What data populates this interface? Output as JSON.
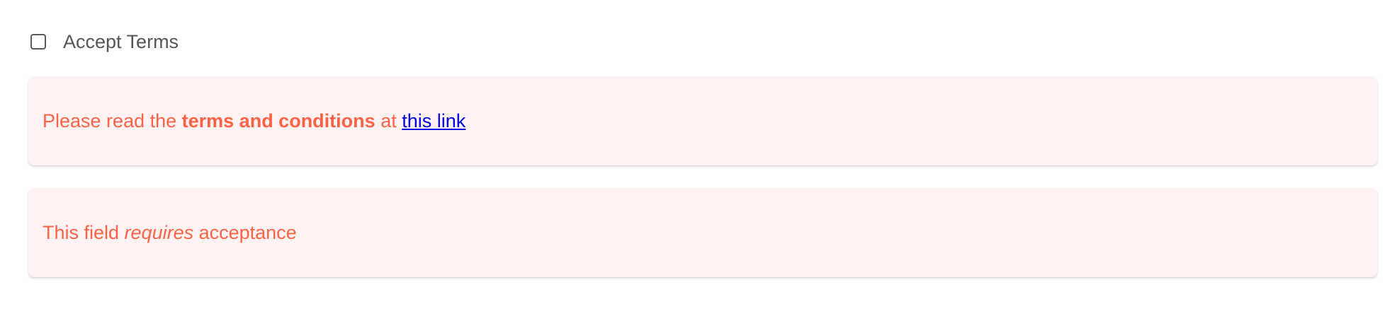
{
  "checkbox": {
    "label": "Accept Terms",
    "checked": false
  },
  "terms_notice": {
    "prefix": "Please read the ",
    "strong": "terms and conditions",
    "middle": " at ",
    "link_text": "this link"
  },
  "required_notice": {
    "prefix": "This field ",
    "emphasis": "requires",
    "suffix": " acceptance"
  },
  "colors": {
    "error_text": "#ff6347",
    "error_background": "#fff2f2",
    "link": "#0000ee",
    "label_text": "#555555"
  }
}
